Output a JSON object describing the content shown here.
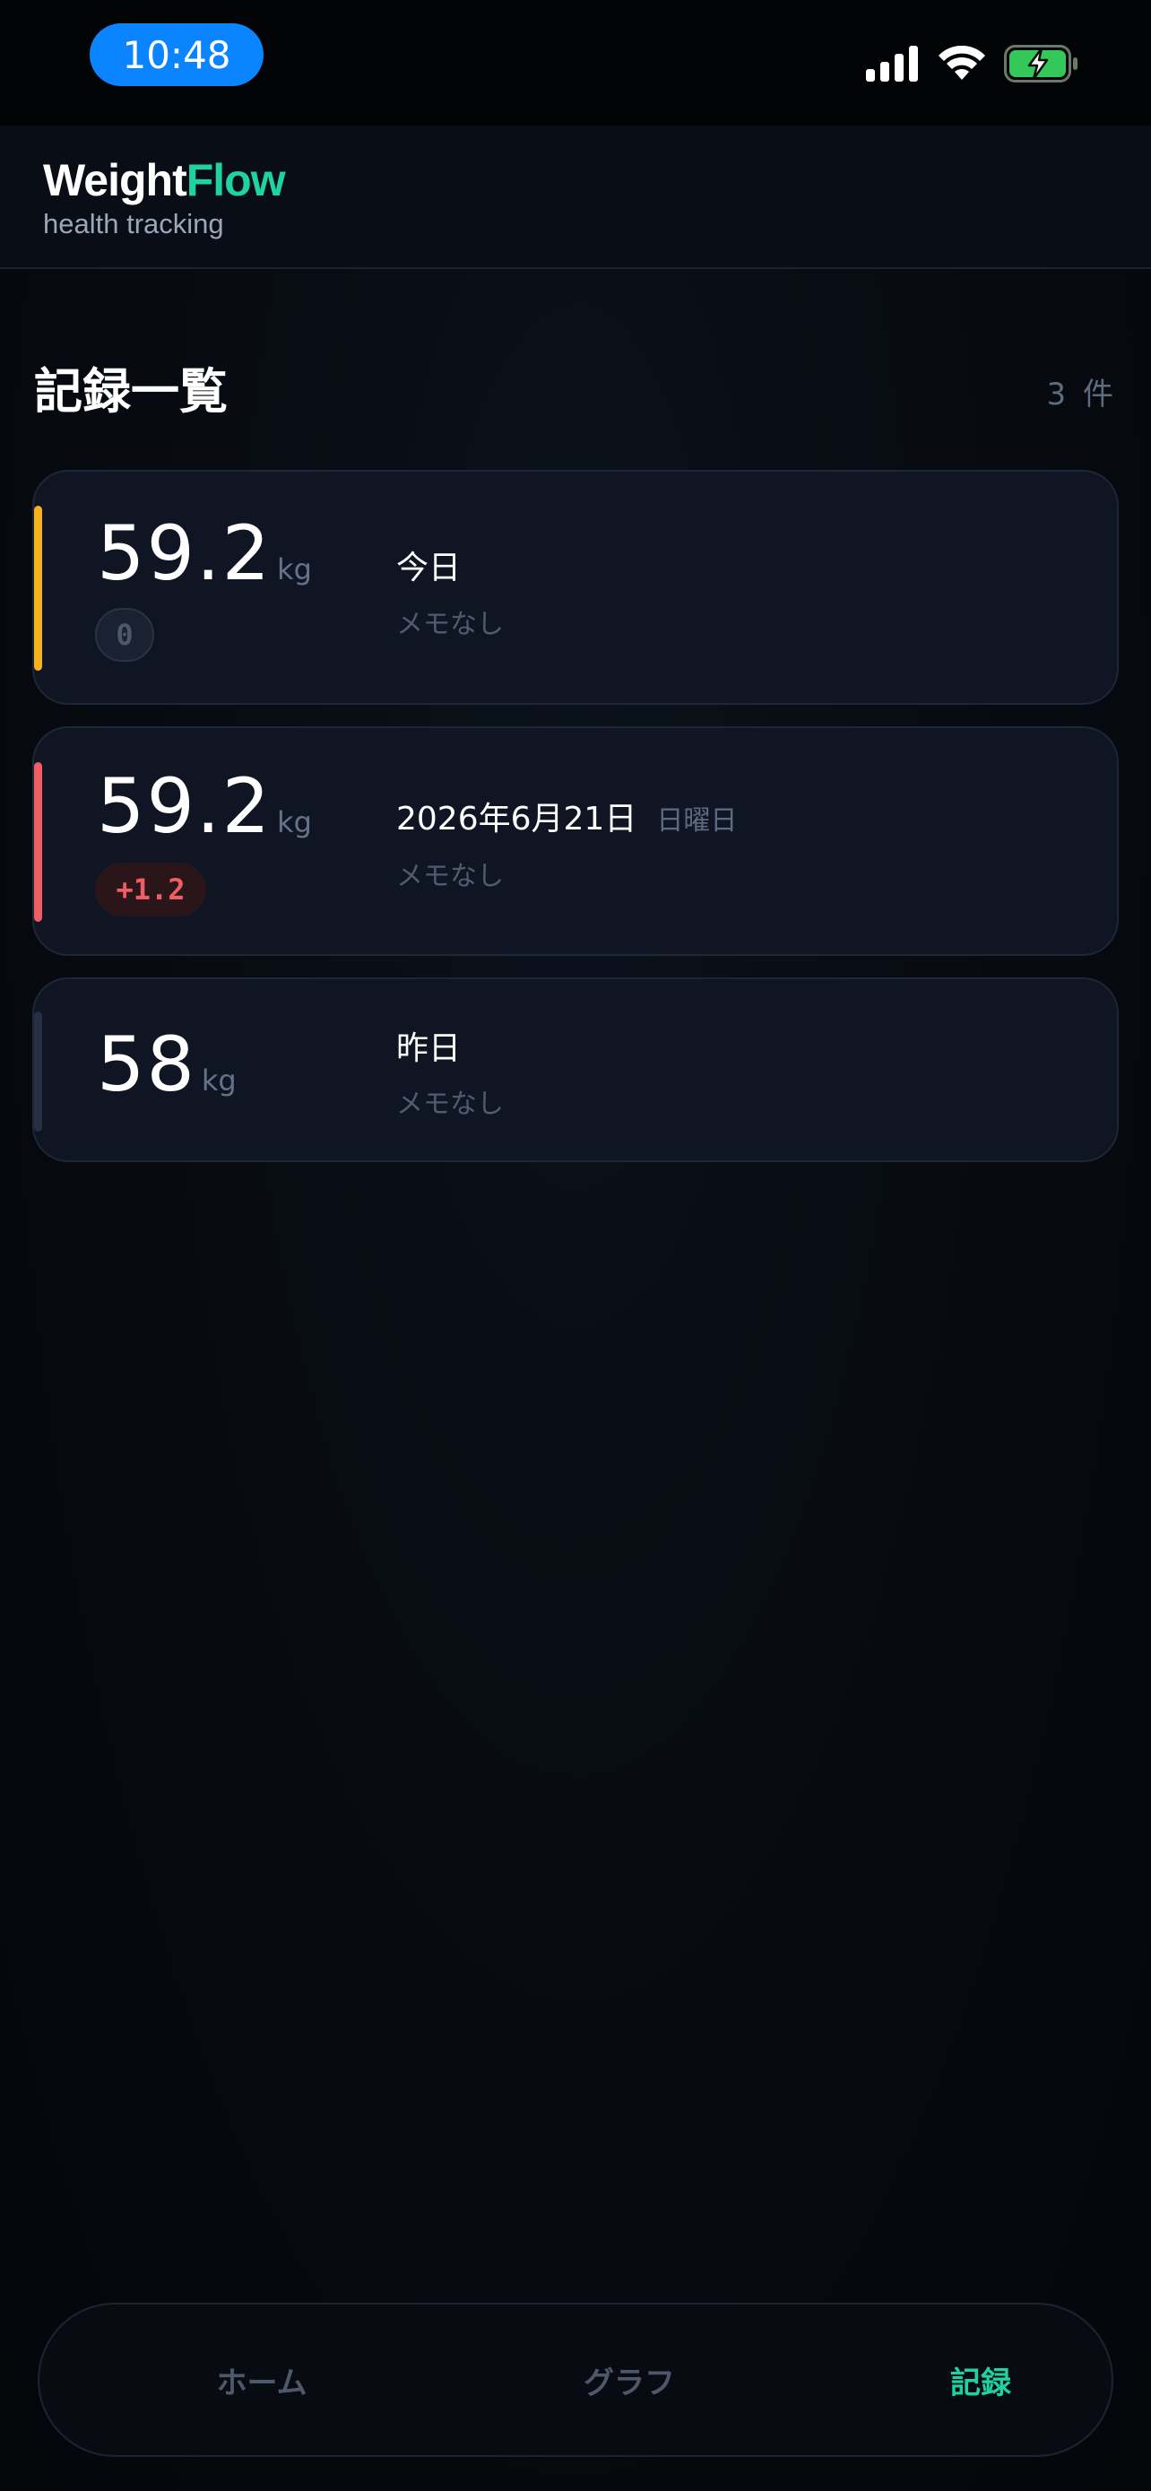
{
  "status_bar": {
    "time": "10:48",
    "icons": [
      "cellular-signal-icon",
      "wifi-icon",
      "battery-charging-icon"
    ],
    "battery_color": "#34c759"
  },
  "header": {
    "brand_primary": "Weight",
    "brand_accent": "Flow",
    "tagline": "health tracking",
    "accent_color": "#1fd3a0"
  },
  "records_section": {
    "title": "記録一覧",
    "count": "3 件"
  },
  "records": [
    {
      "weight": "59.2",
      "unit": "kg",
      "delta": "0",
      "date": "今日",
      "weekday": "",
      "memo": "メモなし",
      "accent_color": "#f5b319"
    },
    {
      "weight": "59.2",
      "unit": "kg",
      "delta": "+1.2",
      "date": "2026年6月21日",
      "weekday": "日曜日",
      "memo": "メモなし",
      "accent_color": "#f05d62"
    },
    {
      "weight": "58",
      "unit": "kg",
      "delta": "",
      "date": "昨日",
      "weekday": "",
      "memo": "メモなし",
      "accent_color": "#263042"
    }
  ],
  "bottom_nav": {
    "items": [
      {
        "label": "ホーム",
        "active": false
      },
      {
        "label": "グラフ",
        "active": false
      },
      {
        "label": "記録",
        "active": true
      }
    ],
    "active_color": "#1fd3a0"
  }
}
